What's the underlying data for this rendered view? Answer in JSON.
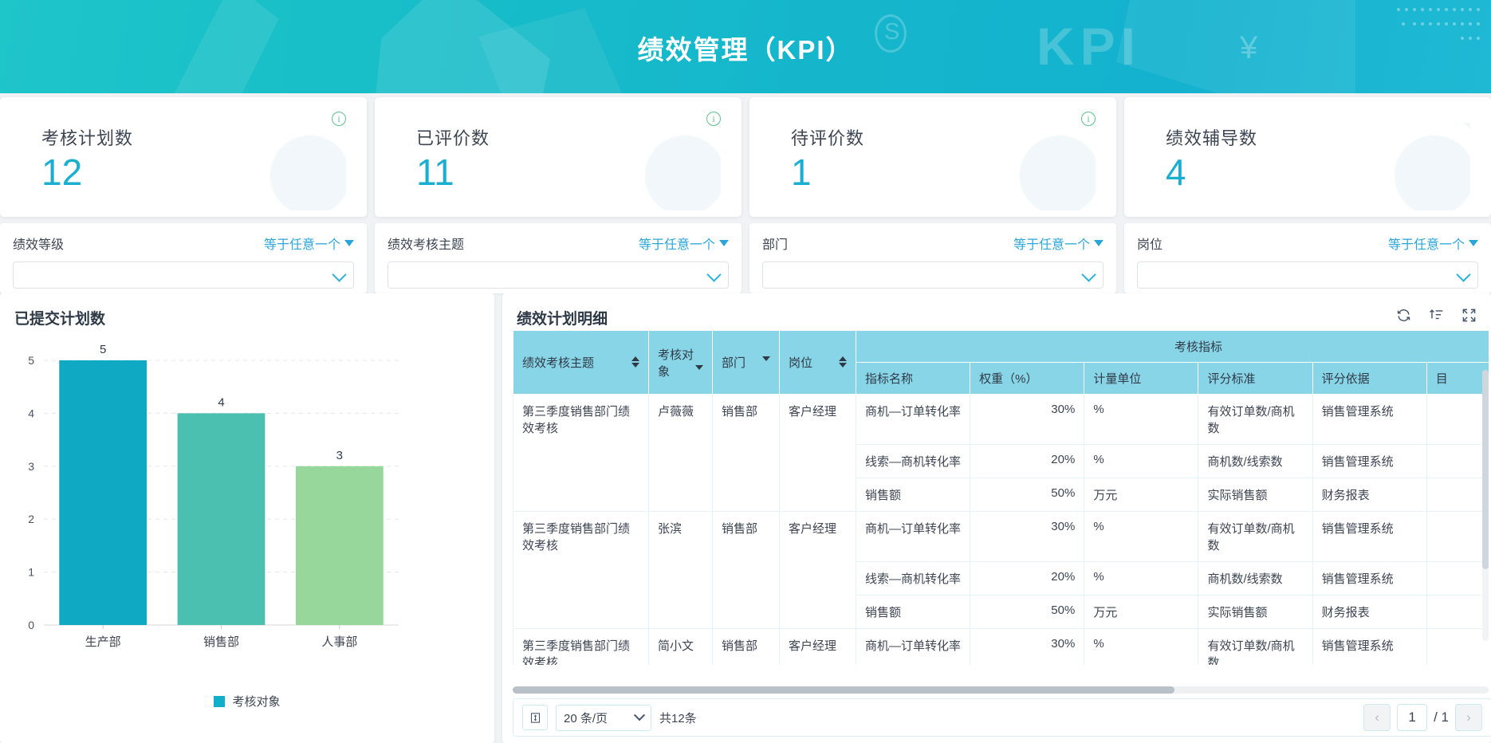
{
  "header": {
    "title": "绩效管理（KPI）",
    "ghost_kpi": "KPI",
    "ghost_yen": "¥"
  },
  "kpi_cards": [
    {
      "label": "考核计划数",
      "value": "12",
      "info": "i"
    },
    {
      "label": "已评价数",
      "value": "11",
      "info": "i"
    },
    {
      "label": "待评价数",
      "value": "1",
      "info": "i"
    },
    {
      "label": "绩效辅导数",
      "value": "4",
      "info": ""
    }
  ],
  "filters": [
    {
      "name": "绩效等级",
      "operator": "等于任意一个",
      "value": "",
      "placeholder": ""
    },
    {
      "name": "绩效考核主题",
      "operator": "等于任意一个",
      "value": "",
      "placeholder": ""
    },
    {
      "name": "部门",
      "operator": "等于任意一个",
      "value": "",
      "placeholder": ""
    },
    {
      "name": "岗位",
      "operator": "等于任意一个",
      "value": "",
      "placeholder": ""
    }
  ],
  "chart_panel": {
    "title": "已提交计划数"
  },
  "chart_data": {
    "type": "bar",
    "title": "已提交计划数",
    "categories": [
      "生产部",
      "销售部",
      "人事部"
    ],
    "values": [
      5,
      4,
      3
    ],
    "colors": [
      "#0fa9c4",
      "#4bbfb0",
      "#97d79c"
    ],
    "series": [
      {
        "name": "考核对象",
        "values": [
          5,
          4,
          3
        ]
      }
    ],
    "legend": [
      "考核对象"
    ],
    "legend_position": "bottom",
    "xlabel": "",
    "ylabel": "",
    "ylim": [
      0,
      5
    ],
    "yticks": [
      0,
      1,
      2,
      3,
      4,
      5
    ],
    "grid": true,
    "data_labels": [
      "5",
      "4",
      "3"
    ]
  },
  "table_panel": {
    "title": "绩效计划明细",
    "tools": [
      "refresh-icon",
      "sort-icon",
      "fullscreen-icon"
    ],
    "group_header": "考核指标",
    "columns": [
      {
        "label": "绩效考核主题",
        "control": "sort"
      },
      {
        "label": "考核对象",
        "control": "filter"
      },
      {
        "label": "部门",
        "control": "filter"
      },
      {
        "label": "岗位",
        "control": "sort"
      }
    ],
    "indicator_columns": [
      "指标名称",
      "权重（%）",
      "计量单位",
      "评分标准",
      "评分依据",
      "目"
    ],
    "rows": [
      {
        "subject": "第三季度销售部门绩效考核",
        "target": "卢薇薇",
        "dept": "销售部",
        "post": "客户经理",
        "indicators": [
          {
            "name": "商机—订单转化率",
            "weight": "30%",
            "unit": "%",
            "criteria": "有效订单数/商机数",
            "basis": "销售管理系统"
          },
          {
            "name": "线索—商机转化率",
            "weight": "20%",
            "unit": "%",
            "criteria": "商机数/线索数",
            "basis": "销售管理系统"
          },
          {
            "name": "销售额",
            "weight": "50%",
            "unit": "万元",
            "criteria": "实际销售额",
            "basis": "财务报表"
          }
        ]
      },
      {
        "subject": "第三季度销售部门绩效考核",
        "target": "张滨",
        "dept": "销售部",
        "post": "客户经理",
        "indicators": [
          {
            "name": "商机—订单转化率",
            "weight": "30%",
            "unit": "%",
            "criteria": "有效订单数/商机数",
            "basis": "销售管理系统"
          },
          {
            "name": "线索—商机转化率",
            "weight": "20%",
            "unit": "%",
            "criteria": "商机数/线索数",
            "basis": "销售管理系统"
          },
          {
            "name": "销售额",
            "weight": "50%",
            "unit": "万元",
            "criteria": "实际销售额",
            "basis": "财务报表"
          }
        ]
      },
      {
        "subject": "第三季度销售部门绩效考核",
        "target": "简小文",
        "dept": "销售部",
        "post": "客户经理",
        "indicators": [
          {
            "name": "商机—订单转化率",
            "weight": "30%",
            "unit": "%",
            "criteria": "有效订单数/商机数",
            "basis": "销售管理系统"
          }
        ]
      }
    ]
  },
  "pagination": {
    "density_icon": "density-icon",
    "page_size": "20 条/页",
    "total": "共12条",
    "prev": "‹",
    "current_page": "1",
    "separator": "/ 1",
    "next": "›"
  }
}
